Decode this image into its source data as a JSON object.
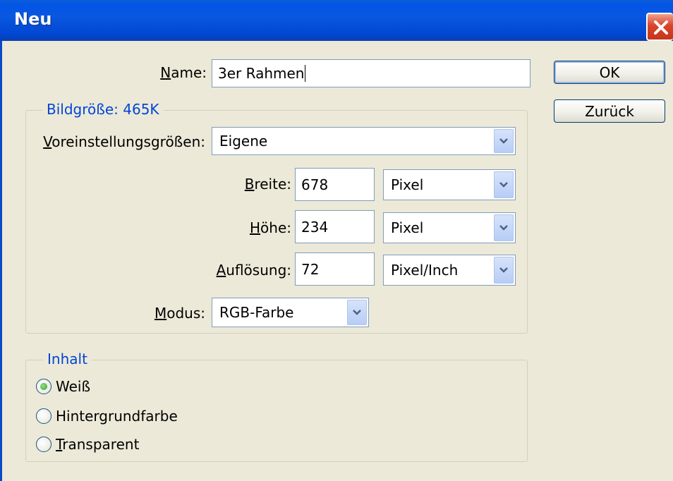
{
  "window": {
    "title": "Neu"
  },
  "name": {
    "label_pre": "",
    "label_u": "N",
    "label_post": "ame:",
    "value": "3er Rahmen"
  },
  "buttons": {
    "ok": "OK",
    "back": "Zurück"
  },
  "image_size": {
    "legend": "Bildgröße: 465K",
    "preset": {
      "label_u": "V",
      "label_post": "oreinstellungsgrößen:",
      "value": "Eigene"
    },
    "width": {
      "label_u": "B",
      "label_post": "reite:",
      "value": "678",
      "unit": "Pixel"
    },
    "height": {
      "label_u": "H",
      "label_post": "öhe:",
      "value": "234",
      "unit": "Pixel"
    },
    "resolution": {
      "label_u": "A",
      "label_post": "uflösung:",
      "value": "72",
      "unit": "Pixel/Inch"
    },
    "mode": {
      "label_u": "M",
      "label_post": "odus:",
      "value": "RGB-Farbe"
    }
  },
  "content": {
    "legend": "Inhalt",
    "options": [
      {
        "label_pre": "",
        "label_u": "",
        "label_post": "Weiß",
        "selected": true
      },
      {
        "label_pre": "",
        "label_u": "",
        "label_post": "Hintergrundfarbe",
        "selected": false
      },
      {
        "label_pre": "",
        "label_u": "T",
        "label_post": "ransparent",
        "selected": false
      }
    ]
  },
  "colors": {
    "titlebar": "#0254e6",
    "legend_text": "#0046d5",
    "dialog_bg": "#ece9d8"
  }
}
